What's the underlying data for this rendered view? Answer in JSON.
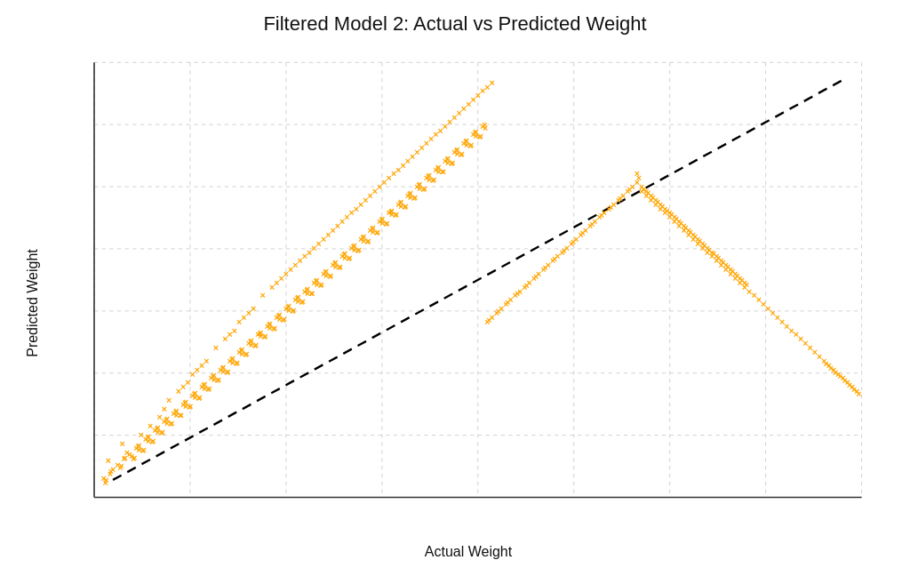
{
  "chart": {
    "title": "Filtered Model 2: Actual vs Predicted Weight",
    "x_label": "Actual Weight",
    "y_label": "Predicted Weight",
    "dot_color": "#FFA500",
    "line_color": "#000000",
    "grid_color": "#cccccc",
    "axis_color": "#333333",
    "points": [
      [
        95,
        180
      ],
      [
        110,
        200
      ],
      [
        120,
        185
      ],
      [
        130,
        210
      ],
      [
        140,
        220
      ],
      [
        150,
        230
      ],
      [
        155,
        240
      ],
      [
        160,
        250
      ],
      [
        170,
        260
      ],
      [
        175,
        265
      ],
      [
        180,
        270
      ],
      [
        185,
        280
      ],
      [
        190,
        285
      ],
      [
        195,
        290
      ],
      [
        200,
        295
      ],
      [
        210,
        310
      ],
      [
        220,
        320
      ],
      [
        225,
        325
      ],
      [
        230,
        330
      ],
      [
        235,
        340
      ],
      [
        240,
        345
      ],
      [
        245,
        350
      ],
      [
        250,
        355
      ],
      [
        260,
        370
      ],
      [
        270,
        380
      ],
      [
        275,
        385
      ],
      [
        280,
        390
      ],
      [
        285,
        395
      ],
      [
        290,
        400
      ],
      [
        295,
        405
      ],
      [
        300,
        410
      ],
      [
        305,
        415
      ],
      [
        310,
        420
      ],
      [
        315,
        425
      ],
      [
        320,
        430
      ],
      [
        325,
        435
      ],
      [
        330,
        440
      ],
      [
        335,
        445
      ],
      [
        340,
        450
      ],
      [
        345,
        455
      ],
      [
        350,
        460
      ],
      [
        355,
        465
      ],
      [
        360,
        470
      ],
      [
        365,
        475
      ],
      [
        370,
        480
      ],
      [
        375,
        485
      ],
      [
        380,
        490
      ],
      [
        385,
        495
      ],
      [
        390,
        500
      ],
      [
        395,
        505
      ],
      [
        400,
        510
      ],
      [
        405,
        515
      ],
      [
        410,
        520
      ],
      [
        415,
        525
      ],
      [
        420,
        530
      ],
      [
        425,
        535
      ],
      [
        430,
        540
      ],
      [
        435,
        545
      ],
      [
        440,
        550
      ],
      [
        445,
        555
      ],
      [
        450,
        560
      ],
      [
        455,
        565
      ],
      [
        460,
        570
      ],
      [
        465,
        575
      ],
      [
        470,
        580
      ],
      [
        475,
        585
      ],
      [
        480,
        590
      ],
      [
        485,
        595
      ],
      [
        490,
        600
      ],
      [
        495,
        605
      ],
      [
        500,
        610
      ],
      [
        505,
        615
      ],
      [
        100,
        170
      ],
      [
        115,
        190
      ],
      [
        125,
        195
      ],
      [
        135,
        205
      ],
      [
        145,
        215
      ],
      [
        155,
        225
      ],
      [
        165,
        235
      ],
      [
        175,
        245
      ],
      [
        185,
        255
      ],
      [
        195,
        265
      ],
      [
        205,
        275
      ],
      [
        215,
        285
      ],
      [
        225,
        295
      ],
      [
        235,
        305
      ],
      [
        245,
        315
      ],
      [
        255,
        325
      ],
      [
        265,
        335
      ],
      [
        275,
        345
      ],
      [
        285,
        355
      ],
      [
        295,
        365
      ],
      [
        305,
        375
      ],
      [
        315,
        385
      ],
      [
        325,
        395
      ],
      [
        335,
        405
      ],
      [
        345,
        415
      ],
      [
        355,
        425
      ],
      [
        365,
        435
      ],
      [
        375,
        445
      ],
      [
        385,
        455
      ],
      [
        395,
        465
      ],
      [
        405,
        475
      ],
      [
        415,
        485
      ],
      [
        425,
        495
      ],
      [
        435,
        505
      ],
      [
        445,
        515
      ],
      [
        455,
        525
      ],
      [
        465,
        535
      ],
      [
        475,
        545
      ],
      [
        485,
        555
      ],
      [
        495,
        565
      ],
      [
        90,
        160
      ],
      [
        105,
        175
      ],
      [
        118,
        188
      ],
      [
        128,
        198
      ],
      [
        138,
        208
      ],
      [
        148,
        218
      ],
      [
        158,
        228
      ],
      [
        168,
        238
      ],
      [
        178,
        248
      ],
      [
        188,
        258
      ],
      [
        198,
        268
      ],
      [
        208,
        278
      ],
      [
        218,
        288
      ],
      [
        228,
        298
      ],
      [
        238,
        308
      ],
      [
        248,
        318
      ],
      [
        258,
        328
      ],
      [
        268,
        338
      ],
      [
        278,
        348
      ],
      [
        288,
        358
      ],
      [
        298,
        368
      ],
      [
        308,
        378
      ],
      [
        318,
        388
      ],
      [
        328,
        398
      ],
      [
        338,
        408
      ],
      [
        348,
        418
      ],
      [
        358,
        428
      ],
      [
        368,
        438
      ],
      [
        378,
        448
      ],
      [
        388,
        458
      ],
      [
        398,
        468
      ],
      [
        408,
        478
      ],
      [
        418,
        488
      ],
      [
        428,
        498
      ],
      [
        438,
        508
      ],
      [
        448,
        518
      ],
      [
        458,
        528
      ],
      [
        468,
        538
      ],
      [
        478,
        548
      ],
      [
        488,
        558
      ],
      [
        92,
        155
      ],
      [
        108,
        172
      ],
      [
        122,
        182
      ],
      [
        132,
        192
      ],
      [
        142,
        202
      ],
      [
        152,
        212
      ],
      [
        162,
        222
      ],
      [
        172,
        232
      ],
      [
        182,
        242
      ],
      [
        192,
        252
      ],
      [
        202,
        262
      ],
      [
        212,
        272
      ],
      [
        222,
        282
      ],
      [
        232,
        292
      ],
      [
        242,
        302
      ],
      [
        252,
        312
      ],
      [
        262,
        322
      ],
      [
        272,
        332
      ],
      [
        282,
        342
      ],
      [
        292,
        352
      ],
      [
        302,
        362
      ],
      [
        312,
        372
      ],
      [
        322,
        382
      ],
      [
        332,
        392
      ],
      [
        342,
        402
      ],
      [
        352,
        412
      ],
      [
        362,
        422
      ],
      [
        372,
        432
      ],
      [
        382,
        442
      ],
      [
        392,
        452
      ],
      [
        402,
        462
      ],
      [
        412,
        472
      ],
      [
        422,
        482
      ],
      [
        432,
        492
      ],
      [
        442,
        502
      ],
      [
        452,
        512
      ],
      [
        462,
        522
      ],
      [
        472,
        532
      ],
      [
        482,
        542
      ],
      [
        492,
        552
      ],
      [
        97,
        165
      ],
      [
        112,
        182
      ],
      [
        127,
        197
      ],
      [
        137,
        207
      ],
      [
        147,
        217
      ],
      [
        157,
        227
      ],
      [
        167,
        237
      ],
      [
        177,
        247
      ],
      [
        187,
        257
      ],
      [
        197,
        267
      ],
      [
        207,
        277
      ],
      [
        217,
        287
      ],
      [
        227,
        297
      ],
      [
        237,
        307
      ],
      [
        247,
        317
      ],
      [
        257,
        327
      ],
      [
        267,
        337
      ],
      [
        277,
        347
      ],
      [
        287,
        357
      ],
      [
        297,
        367
      ],
      [
        307,
        377
      ],
      [
        317,
        387
      ],
      [
        327,
        397
      ],
      [
        337,
        407
      ],
      [
        347,
        417
      ],
      [
        357,
        427
      ],
      [
        367,
        437
      ],
      [
        377,
        447
      ],
      [
        387,
        457
      ],
      [
        397,
        467
      ],
      [
        407,
        477
      ],
      [
        417,
        487
      ],
      [
        427,
        497
      ],
      [
        437,
        507
      ],
      [
        447,
        517
      ],
      [
        457,
        527
      ],
      [
        467,
        537
      ],
      [
        477,
        547
      ],
      [
        487,
        557
      ],
      [
        497,
        567
      ],
      [
        93,
        158
      ],
      [
        109,
        174
      ],
      [
        123,
        183
      ],
      [
        133,
        193
      ],
      [
        143,
        203
      ],
      [
        153,
        213
      ],
      [
        163,
        223
      ],
      [
        173,
        233
      ],
      [
        183,
        243
      ],
      [
        193,
        253
      ],
      [
        203,
        263
      ],
      [
        213,
        273
      ],
      [
        223,
        283
      ],
      [
        233,
        293
      ],
      [
        243,
        303
      ],
      [
        253,
        313
      ],
      [
        263,
        323
      ],
      [
        273,
        333
      ],
      [
        283,
        343
      ],
      [
        293,
        353
      ],
      [
        303,
        363
      ],
      [
        313,
        373
      ],
      [
        323,
        383
      ],
      [
        333,
        393
      ],
      [
        343,
        403
      ],
      [
        353,
        413
      ],
      [
        363,
        423
      ],
      [
        373,
        433
      ],
      [
        383,
        443
      ],
      [
        393,
        453
      ],
      [
        403,
        463
      ],
      [
        413,
        473
      ],
      [
        423,
        483
      ],
      [
        433,
        493
      ],
      [
        443,
        503
      ],
      [
        453,
        513
      ],
      [
        463,
        523
      ],
      [
        473,
        533
      ],
      [
        483,
        543
      ],
      [
        493,
        553
      ],
      [
        98,
        168
      ],
      [
        113,
        183
      ],
      [
        128,
        193
      ],
      [
        138,
        203
      ],
      [
        148,
        213
      ],
      [
        158,
        223
      ],
      [
        168,
        233
      ],
      [
        178,
        243
      ],
      [
        188,
        253
      ],
      [
        198,
        263
      ],
      [
        208,
        273
      ],
      [
        218,
        283
      ],
      [
        228,
        293
      ],
      [
        238,
        303
      ],
      [
        248,
        313
      ],
      [
        258,
        323
      ],
      [
        268,
        333
      ],
      [
        278,
        343
      ],
      [
        288,
        353
      ],
      [
        298,
        363
      ],
      [
        308,
        373
      ],
      [
        318,
        383
      ],
      [
        328,
        393
      ],
      [
        338,
        403
      ],
      [
        348,
        413
      ],
      [
        358,
        423
      ],
      [
        368,
        433
      ],
      [
        378,
        443
      ],
      [
        388,
        453
      ],
      [
        398,
        463
      ],
      [
        408,
        473
      ],
      [
        418,
        483
      ],
      [
        428,
        493
      ],
      [
        438,
        503
      ],
      [
        448,
        513
      ],
      [
        458,
        523
      ],
      [
        468,
        533
      ],
      [
        478,
        543
      ],
      [
        488,
        553
      ],
      [
        498,
        563
      ],
      [
        500,
        340
      ],
      [
        510,
        350
      ],
      [
        520,
        360
      ],
      [
        530,
        370
      ],
      [
        540,
        380
      ],
      [
        550,
        390
      ],
      [
        560,
        400
      ],
      [
        570,
        410
      ],
      [
        580,
        420
      ],
      [
        590,
        430
      ],
      [
        600,
        440
      ],
      [
        610,
        450
      ],
      [
        620,
        460
      ],
      [
        630,
        470
      ],
      [
        640,
        480
      ],
      [
        650,
        490
      ],
      [
        505,
        345
      ],
      [
        515,
        355
      ],
      [
        525,
        365
      ],
      [
        535,
        375
      ],
      [
        545,
        385
      ],
      [
        555,
        395
      ],
      [
        565,
        405
      ],
      [
        575,
        415
      ],
      [
        585,
        425
      ],
      [
        595,
        435
      ],
      [
        605,
        445
      ],
      [
        615,
        455
      ],
      [
        625,
        465
      ],
      [
        635,
        475
      ],
      [
        645,
        485
      ],
      [
        655,
        495
      ],
      [
        502,
        342
      ],
      [
        512,
        352
      ],
      [
        522,
        362
      ],
      [
        532,
        372
      ],
      [
        542,
        382
      ],
      [
        552,
        392
      ],
      [
        562,
        402
      ],
      [
        572,
        412
      ],
      [
        582,
        422
      ],
      [
        592,
        432
      ],
      [
        602,
        442
      ],
      [
        612,
        452
      ],
      [
        622,
        462
      ],
      [
        632,
        472
      ],
      [
        642,
        482
      ],
      [
        652,
        492
      ],
      [
        660,
        500
      ],
      [
        665,
        490
      ],
      [
        670,
        485
      ],
      [
        675,
        480
      ],
      [
        680,
        475
      ],
      [
        685,
        470
      ],
      [
        690,
        465
      ],
      [
        695,
        460
      ],
      [
        700,
        455
      ],
      [
        705,
        450
      ],
      [
        710,
        445
      ],
      [
        715,
        440
      ],
      [
        720,
        435
      ],
      [
        725,
        430
      ],
      [
        730,
        425
      ],
      [
        735,
        420
      ],
      [
        740,
        415
      ],
      [
        745,
        410
      ],
      [
        750,
        405
      ],
      [
        755,
        400
      ],
      [
        760,
        395
      ],
      [
        765,
        390
      ],
      [
        770,
        385
      ],
      [
        775,
        380
      ],
      [
        780,
        375
      ],
      [
        785,
        370
      ],
      [
        790,
        365
      ],
      [
        795,
        360
      ],
      [
        800,
        355
      ],
      [
        805,
        350
      ],
      [
        810,
        345
      ],
      [
        815,
        340
      ],
      [
        820,
        335
      ],
      [
        825,
        330
      ],
      [
        830,
        325
      ],
      [
        835,
        320
      ],
      [
        840,
        315
      ],
      [
        845,
        310
      ],
      [
        850,
        305
      ],
      [
        855,
        300
      ],
      [
        660,
        510
      ],
      [
        665,
        495
      ],
      [
        670,
        490
      ],
      [
        675,
        485
      ],
      [
        680,
        480
      ],
      [
        685,
        475
      ],
      [
        690,
        470
      ],
      [
        695,
        465
      ],
      [
        700,
        460
      ],
      [
        705,
        455
      ],
      [
        710,
        450
      ],
      [
        715,
        445
      ],
      [
        720,
        440
      ],
      [
        725,
        435
      ],
      [
        730,
        430
      ],
      [
        735,
        425
      ],
      [
        740,
        420
      ],
      [
        745,
        415
      ],
      [
        750,
        410
      ],
      [
        755,
        405
      ],
      [
        760,
        400
      ],
      [
        765,
        395
      ],
      [
        770,
        390
      ],
      [
        775,
        385
      ],
      [
        662,
        505
      ],
      [
        667,
        492
      ],
      [
        672,
        488
      ],
      [
        677,
        483
      ],
      [
        682,
        478
      ],
      [
        687,
        473
      ],
      [
        692,
        468
      ],
      [
        697,
        463
      ],
      [
        702,
        458
      ],
      [
        707,
        453
      ],
      [
        712,
        448
      ],
      [
        717,
        443
      ],
      [
        722,
        438
      ],
      [
        727,
        433
      ],
      [
        732,
        428
      ],
      [
        737,
        423
      ],
      [
        742,
        418
      ],
      [
        747,
        413
      ],
      [
        752,
        408
      ],
      [
        757,
        403
      ],
      [
        762,
        398
      ],
      [
        767,
        393
      ],
      [
        772,
        388
      ],
      [
        777,
        383
      ],
      [
        860,
        295
      ],
      [
        865,
        290
      ],
      [
        870,
        285
      ],
      [
        875,
        280
      ],
      [
        880,
        275
      ],
      [
        885,
        270
      ],
      [
        890,
        265
      ],
      [
        895,
        260
      ],
      [
        862,
        292
      ],
      [
        867,
        287
      ],
      [
        872,
        282
      ],
      [
        877,
        277
      ],
      [
        882,
        272
      ],
      [
        887,
        267
      ],
      [
        892,
        262
      ],
      [
        897,
        257
      ]
    ]
  }
}
